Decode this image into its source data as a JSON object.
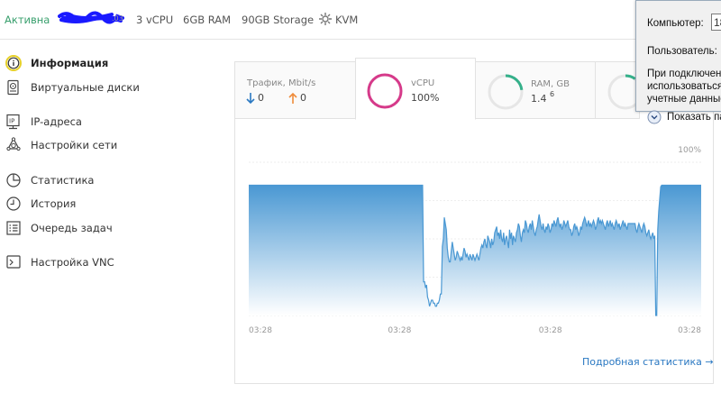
{
  "header": {
    "status": "Активна",
    "cpu": "3 vCPU",
    "ram": "6GB RAM",
    "storage": "90GB Storage",
    "virt": "KVM"
  },
  "sidebar": {
    "items": [
      {
        "label": "Информация",
        "icon": "info-icon",
        "active": true
      },
      {
        "label": "Виртуальные диски",
        "icon": "disk-icon"
      },
      {
        "label": "IP-адреса",
        "icon": "ip-icon"
      },
      {
        "label": "Настройки сети",
        "icon": "network-icon"
      },
      {
        "label": "Статистика",
        "icon": "pie-chart-icon"
      },
      {
        "label": "История",
        "icon": "clock-icon"
      },
      {
        "label": "Очередь задач",
        "icon": "list-icon"
      },
      {
        "label": "Настройка VNC",
        "icon": "vnc-icon"
      }
    ]
  },
  "tabs": {
    "traffic": {
      "label": "Трафик, Mbit/s",
      "down": "0",
      "up": "0"
    },
    "vcpu": {
      "label": "vCPU",
      "value": "100%",
      "percent": 100
    },
    "ram": {
      "label": "RAM, GB",
      "used": "1.4",
      "total": "6",
      "fraction": 0.23
    },
    "disk": {
      "fraction": 0.1
    }
  },
  "chart_data": {
    "type": "area",
    "title": "",
    "ylabel": "",
    "y_tick_label": "100%",
    "ylim": [
      0,
      100
    ],
    "x_tick_labels": [
      "03:28",
      "03:28",
      "03:28",
      "03:28"
    ],
    "fill_color": "#4a98d3",
    "values": [
      85,
      85,
      85,
      85,
      85,
      85,
      85,
      85,
      85,
      85,
      85,
      85,
      85,
      85,
      85,
      85,
      85,
      85,
      85,
      85,
      85,
      85,
      85,
      85,
      85,
      85,
      85,
      85,
      85,
      85,
      85,
      85,
      85,
      85,
      85,
      85,
      85,
      85,
      85,
      85,
      85,
      85,
      85,
      85,
      85,
      85,
      85,
      85,
      85,
      85,
      85,
      85,
      85,
      85,
      85,
      85,
      85,
      85,
      85,
      85,
      85,
      85,
      85,
      85,
      85,
      85,
      85,
      85,
      85,
      85,
      85,
      85,
      85,
      85,
      85,
      85,
      85,
      85,
      85,
      85,
      85,
      85,
      85,
      85,
      85,
      85,
      85,
      85,
      85,
      85,
      85,
      85,
      85,
      85,
      85,
      85,
      85,
      85,
      85,
      85,
      85,
      85,
      85,
      85,
      85,
      85,
      85,
      85,
      85,
      85,
      85,
      85,
      85,
      85,
      85,
      85,
      85,
      85,
      85,
      85,
      85,
      85,
      85,
      85,
      85,
      85,
      85,
      85,
      85,
      85,
      85,
      85,
      85,
      85,
      85,
      85,
      85,
      85,
      85,
      85,
      85,
      85,
      85,
      85,
      85,
      85,
      85,
      85,
      85,
      85,
      85,
      85,
      85,
      85,
      85,
      85,
      85,
      85,
      85,
      85,
      85,
      85,
      85,
      85,
      85,
      85,
      85,
      85,
      85,
      85,
      85,
      85,
      85,
      85,
      85,
      85,
      85,
      22,
      22,
      18,
      20,
      12,
      10,
      6,
      8,
      10,
      10,
      8,
      8,
      6,
      6,
      8,
      8,
      10,
      14,
      14,
      45,
      50,
      64,
      60,
      56,
      44,
      38,
      35,
      35,
      42,
      48,
      44,
      40,
      36,
      38,
      42,
      40,
      38,
      36,
      38,
      36,
      40,
      44,
      42,
      38,
      40,
      38,
      36,
      40,
      38,
      36,
      40,
      38,
      36,
      38,
      40,
      38,
      36,
      40,
      44,
      46,
      44,
      48,
      50,
      46,
      44,
      52,
      50,
      48,
      44,
      50,
      46,
      48,
      54,
      56,
      58,
      52,
      54,
      50,
      56,
      50,
      48,
      54,
      46,
      50,
      52,
      48,
      44,
      56,
      50,
      54,
      46,
      52,
      50,
      48,
      54,
      56,
      60,
      58,
      52,
      48,
      54,
      56,
      54,
      62,
      60,
      56,
      54,
      58,
      60,
      56,
      62,
      58,
      54,
      52,
      56,
      58,
      62,
      66,
      62,
      58,
      56,
      60,
      56,
      54,
      58,
      56,
      60,
      58,
      54,
      56,
      60,
      58,
      62,
      60,
      58,
      62,
      64,
      60,
      58,
      60,
      56,
      58,
      62,
      60,
      58,
      60,
      62,
      58,
      56,
      56,
      52,
      54,
      58,
      60,
      56,
      58,
      56,
      52,
      54,
      58,
      56,
      60,
      62,
      64,
      62,
      58,
      60,
      62,
      58,
      60,
      58,
      60,
      62,
      60,
      56,
      58,
      62,
      64,
      60,
      62,
      60,
      62,
      60,
      58,
      56,
      60,
      62,
      58,
      60,
      62,
      58,
      60,
      58,
      56,
      60,
      62,
      60,
      58,
      60,
      56,
      58,
      60,
      62,
      58,
      60,
      58,
      56,
      60,
      60,
      60,
      60,
      60,
      60,
      60,
      60,
      56,
      54,
      58,
      60,
      58,
      56,
      54,
      58,
      60,
      58,
      54,
      52,
      54,
      56,
      52,
      50,
      52,
      54,
      50,
      52,
      0,
      0,
      56,
      68,
      76,
      84,
      85,
      85,
      85,
      85,
      85,
      85,
      85,
      85,
      85,
      85,
      85,
      85,
      85,
      85,
      85,
      85,
      85,
      85,
      85,
      85,
      85,
      85,
      85,
      85,
      85,
      85,
      85,
      85,
      85,
      85,
      85,
      85,
      85,
      85,
      85,
      85,
      85,
      85,
      85,
      85,
      85
    ]
  },
  "footer": {
    "detail_link": "Подробная статистика →"
  },
  "popup": {
    "computer_label": "Компьютер:",
    "computer_value": "18",
    "user_label": "Пользователь:",
    "msg1": "При подключени",
    "msg2": "использоваться",
    "msg3": "учетные данные",
    "toggle": "Показать па"
  }
}
